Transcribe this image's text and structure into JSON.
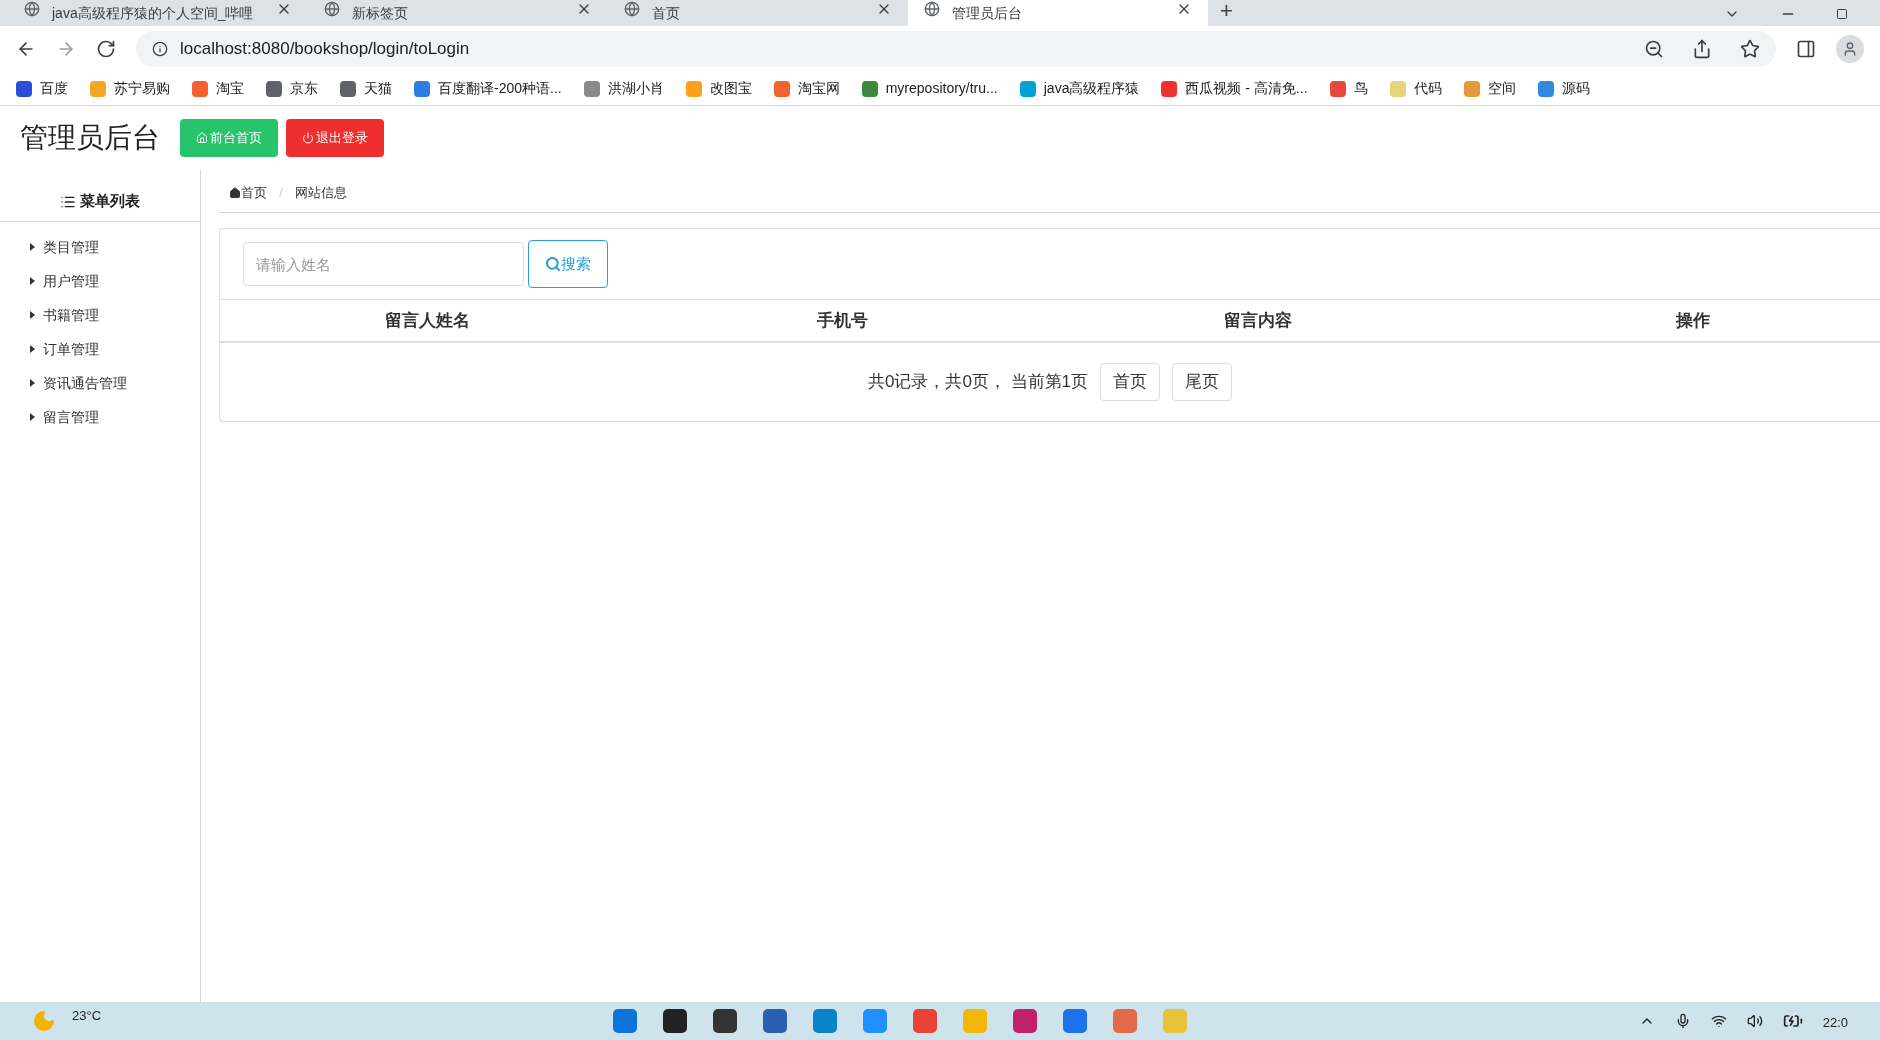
{
  "browser": {
    "tabs": [
      {
        "title": "java高级程序猿的个人空间_哔哩",
        "selected": false
      },
      {
        "title": "新标签页",
        "selected": false
      },
      {
        "title": "首页",
        "selected": false
      },
      {
        "title": "管理员后台",
        "selected": true
      }
    ],
    "new_tab": "+",
    "url": "localhost:8080/bookshop/login/toLogin",
    "bookmarks": [
      {
        "label": "百度",
        "color": "#2b4fd6"
      },
      {
        "label": "苏宁易购",
        "color": "#f5a623"
      },
      {
        "label": "淘宝",
        "color": "#f2622e"
      },
      {
        "label": "京东",
        "color": "#5f6368"
      },
      {
        "label": "天猫",
        "color": "#5f6368"
      },
      {
        "label": "百度翻译-200种语...",
        "color": "#2f7de1"
      },
      {
        "label": "洪湖小肖",
        "color": "#888888"
      },
      {
        "label": "改图宝",
        "color": "#ff9f1a"
      },
      {
        "label": "淘宝网",
        "color": "#f2622e"
      },
      {
        "label": "myrepository/tru...",
        "color": "#3b8a3b"
      },
      {
        "label": "java高级程序猿",
        "color": "#00a1d6"
      },
      {
        "label": "西瓜视频 - 高清免...",
        "color": "#f0302f"
      },
      {
        "label": "鸟",
        "color": "#e8473b"
      },
      {
        "label": "代码",
        "color": "#e8d37a"
      },
      {
        "label": "空间",
        "color": "#e89a3b"
      },
      {
        "label": "源码",
        "color": "#2f8ae0"
      }
    ]
  },
  "header": {
    "title": "管理员后台",
    "buttons": [
      {
        "label": "前台首页",
        "kind": "home"
      },
      {
        "label": "退出登录",
        "kind": "logout"
      }
    ]
  },
  "sidebar": {
    "title": "菜单列表",
    "items": [
      {
        "label": "类目管理",
        "expanded": false
      },
      {
        "label": "用户管理",
        "expanded": false
      },
      {
        "label": "书籍管理",
        "expanded": false
      },
      {
        "label": "订单管理",
        "expanded": false
      },
      {
        "label": "资讯通告管理",
        "expanded": false
      },
      {
        "label": "留言管理",
        "expanded": false
      }
    ]
  },
  "breadcrumb_separator": "/",
  "breadcrumb": [
    {
      "label": "首页",
      "kind": "home"
    },
    {
      "label": "网站信息",
      "kind": "current"
    }
  ],
  "search": {
    "placeholder": "请输入姓名",
    "button": "搜索"
  },
  "table": {
    "columns": [
      "留言人姓名",
      "手机号",
      "留言内容",
      "操作"
    ]
  },
  "pagination": {
    "summary": "共0记录，共0页， 当前第1页",
    "buttons": [
      "首页",
      "尾页"
    ]
  },
  "taskbar": {
    "temperature": "23°C",
    "clock": "22:0"
  }
}
